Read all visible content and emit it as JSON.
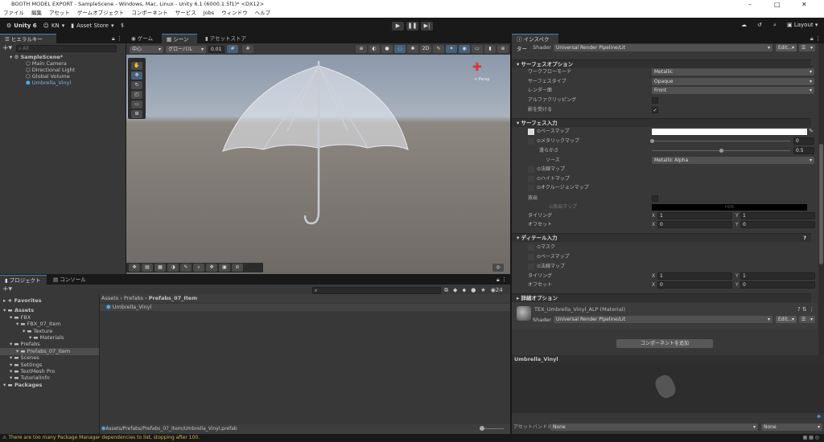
{
  "window": {
    "title": "BOOTH MODEL EXPORT - SampleScene - Windows, Mac, Linux - Unity 6.1 (6000.1.5f1)* <DX12>"
  },
  "menu": [
    "ファイル",
    "編集",
    "アセット",
    "ゲームオブジェクト",
    "コンポーネント",
    "サービス",
    "Jobs",
    "ウィンドウ",
    "ヘルプ"
  ],
  "toolbar": {
    "unity": "Unity 6",
    "account": "KN",
    "asset_store": "Asset Store",
    "layout": "Layout"
  },
  "hierarchy": {
    "tab": "ヒエラルキー",
    "search_placeholder": "All",
    "scene": "SampleScene*",
    "items": [
      "Main Camera",
      "Directional Light",
      "Global Volume",
      "Umbrella_Vinyl"
    ]
  },
  "scene": {
    "tabs": [
      "ゲーム",
      "シーン",
      "アセットストア"
    ],
    "pivot": "中心",
    "space": "グローバル",
    "snap": "0.01",
    "persp": "< Persp"
  },
  "project": {
    "tabs": [
      "プロジェクト",
      "コンソール"
    ],
    "count": "24",
    "tree": [
      {
        "label": "Favorites",
        "level": 0,
        "bold": true
      },
      {
        "label": "Assets",
        "level": 0,
        "bold": true
      },
      {
        "label": "FBX",
        "level": 1
      },
      {
        "label": "FBX_07_Item",
        "level": 2
      },
      {
        "label": "Texture",
        "level": 3
      },
      {
        "label": "Materials",
        "level": 4
      },
      {
        "label": "Prefabs",
        "level": 1
      },
      {
        "label": "Prefabs_07_Item",
        "level": 2,
        "selected": true
      },
      {
        "label": "Scenes",
        "level": 1
      },
      {
        "label": "Settings",
        "level": 1
      },
      {
        "label": "TextMesh Pro",
        "level": 1
      },
      {
        "label": "TutorialInfo",
        "level": 1
      },
      {
        "label": "Packages",
        "level": 0,
        "bold": true
      }
    ],
    "breadcrumb": [
      "Assets",
      "Prefabs",
      "Prefabs_07_Item"
    ],
    "file": "Umbrella_Vinyl",
    "path": "Assets/Prefabs/Prefabs_07_Item/Umbrella_Vinyl.prefab"
  },
  "inspector": {
    "tab": "インスペクター",
    "shader_label": "Shader",
    "shader": "Universal Render Pipeline/Lit",
    "edit": "Edit...",
    "surface_options": {
      "title": "サーフェスオプション",
      "workflow_label": "ワークフローモード",
      "workflow": "Metallic",
      "surface_type_label": "サーフェスタイプ",
      "surface_type": "Opaque",
      "render_face_label": "レンダー面",
      "render_face": "Front",
      "alpha_clip_label": "アルファクリッピング",
      "receive_shadows_label": "影を受ける"
    },
    "surface_inputs": {
      "title": "サーフェス入力",
      "base_map": "ベースマップ",
      "metallic_map": "メタリックマップ",
      "metallic": "0",
      "metallic_fraction": 0,
      "smoothness_label": "滑らかさ",
      "smoothness": "0.5",
      "smoothness_fraction": 0.5,
      "source_label": "ソース",
      "source": "Metallic Alpha",
      "normal_map": "法線マップ",
      "height_map": "ハイトマップ",
      "occlusion_map": "オクルージョンマップ",
      "emission": "放出",
      "emission_map": "放出マップ",
      "hdr": "HDR",
      "tiling": "タイリング",
      "offset": "オフセット",
      "tx": "1",
      "ty": "1",
      "ox": "0",
      "oy": "0"
    },
    "detail_inputs": {
      "title": "ディテール入力",
      "mask": "マスク",
      "base_map": "ベースマップ",
      "normal_map": "法線マップ",
      "tiling": "タイリング",
      "offset": "オフセット",
      "tx": "1",
      "ty": "1",
      "ox": "0",
      "oy": "0"
    },
    "advanced": "詳細オプション",
    "material": "TEX_Umbrella_Vinyl_ALP (Material)",
    "add_component": "コンポーネントを追加",
    "preview_title": "Umbrella_Vinyl",
    "asset_bundle_label": "アセットバンドル",
    "asset_bundle": "None",
    "asset_variant": "None"
  },
  "status": {
    "message": "There are too many Package Manager dependencies to list, stopping after 100."
  }
}
